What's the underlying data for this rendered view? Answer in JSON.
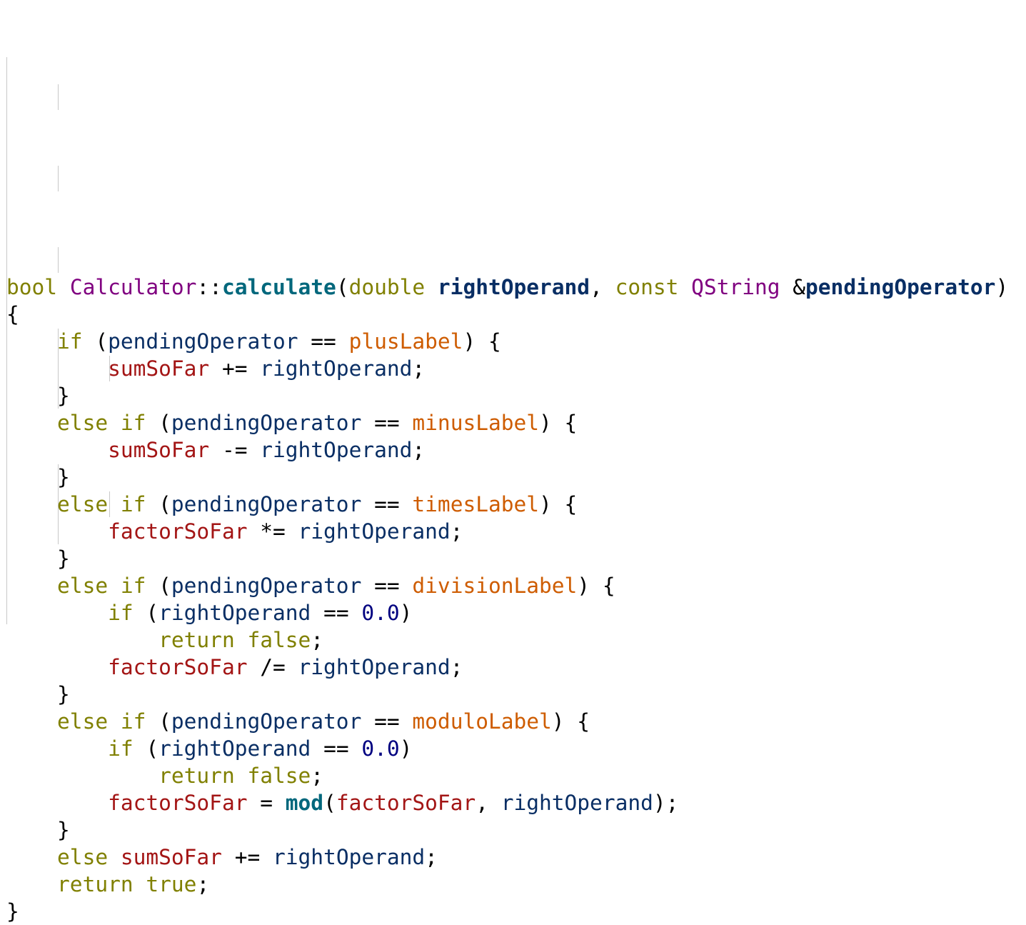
{
  "colors": {
    "background": "#ffffff",
    "indent_guide": "#c8c8c8",
    "k": "#808000",
    "t": "#800080",
    "f": "#00677c",
    "p": "#092e64",
    "m": "#a31515",
    "e": "#ce5c00",
    "n": "#000080",
    "o": "#000000",
    "d": "#000000",
    "bd": "#092e64"
  },
  "code": {
    "lines": [
      [
        [
          "k",
          "bool"
        ],
        [
          "d",
          " "
        ],
        [
          "t",
          "Calculator"
        ],
        [
          "d",
          "::"
        ],
        [
          "f",
          "calculate"
        ],
        [
          "d",
          "("
        ],
        [
          "k",
          "double"
        ],
        [
          "d",
          " "
        ],
        [
          "bd",
          "rightOperand"
        ],
        [
          "d",
          ", "
        ],
        [
          "k",
          "const"
        ],
        [
          "d",
          " "
        ],
        [
          "t",
          "QString"
        ],
        [
          "d",
          " &"
        ],
        [
          "bd",
          "pendingOperator"
        ],
        [
          "d",
          ")"
        ]
      ],
      [
        [
          "d",
          "{"
        ]
      ],
      [
        [
          "d",
          "    "
        ],
        [
          "k",
          "if"
        ],
        [
          "d",
          " ("
        ],
        [
          "p",
          "pendingOperator"
        ],
        [
          "d",
          " "
        ],
        [
          "o",
          "=="
        ],
        [
          "d",
          " "
        ],
        [
          "e",
          "plusLabel"
        ],
        [
          "d",
          ") {"
        ]
      ],
      [
        [
          "d",
          "        "
        ],
        [
          "m",
          "sumSoFar"
        ],
        [
          "d",
          " "
        ],
        [
          "o",
          "+="
        ],
        [
          "d",
          " "
        ],
        [
          "p",
          "rightOperand"
        ],
        [
          "d",
          ";"
        ]
      ],
      [
        [
          "d",
          "    }"
        ]
      ],
      [
        [
          "d",
          "    "
        ],
        [
          "k",
          "else"
        ],
        [
          "d",
          " "
        ],
        [
          "k",
          "if"
        ],
        [
          "d",
          " ("
        ],
        [
          "p",
          "pendingOperator"
        ],
        [
          "d",
          " "
        ],
        [
          "o",
          "=="
        ],
        [
          "d",
          " "
        ],
        [
          "e",
          "minusLabel"
        ],
        [
          "d",
          ") {"
        ]
      ],
      [
        [
          "d",
          "        "
        ],
        [
          "m",
          "sumSoFar"
        ],
        [
          "d",
          " "
        ],
        [
          "o",
          "-="
        ],
        [
          "d",
          " "
        ],
        [
          "p",
          "rightOperand"
        ],
        [
          "d",
          ";"
        ]
      ],
      [
        [
          "d",
          "    }"
        ]
      ],
      [
        [
          "d",
          "    "
        ],
        [
          "k",
          "else"
        ],
        [
          "d",
          " "
        ],
        [
          "k",
          "if"
        ],
        [
          "d",
          " ("
        ],
        [
          "p",
          "pendingOperator"
        ],
        [
          "d",
          " "
        ],
        [
          "o",
          "=="
        ],
        [
          "d",
          " "
        ],
        [
          "e",
          "timesLabel"
        ],
        [
          "d",
          ") {"
        ]
      ],
      [
        [
          "d",
          "        "
        ],
        [
          "m",
          "factorSoFar"
        ],
        [
          "d",
          " "
        ],
        [
          "o",
          "*="
        ],
        [
          "d",
          " "
        ],
        [
          "p",
          "rightOperand"
        ],
        [
          "d",
          ";"
        ]
      ],
      [
        [
          "d",
          "    }"
        ]
      ],
      [
        [
          "d",
          "    "
        ],
        [
          "k",
          "else"
        ],
        [
          "d",
          " "
        ],
        [
          "k",
          "if"
        ],
        [
          "d",
          " ("
        ],
        [
          "p",
          "pendingOperator"
        ],
        [
          "d",
          " "
        ],
        [
          "o",
          "=="
        ],
        [
          "d",
          " "
        ],
        [
          "e",
          "divisionLabel"
        ],
        [
          "d",
          ") {"
        ]
      ],
      [
        [
          "d",
          "        "
        ],
        [
          "k",
          "if"
        ],
        [
          "d",
          " ("
        ],
        [
          "p",
          "rightOperand"
        ],
        [
          "d",
          " "
        ],
        [
          "o",
          "=="
        ],
        [
          "d",
          " "
        ],
        [
          "n",
          "0.0"
        ],
        [
          "d",
          ")"
        ]
      ],
      [
        [
          "d",
          "            "
        ],
        [
          "k",
          "return"
        ],
        [
          "d",
          " "
        ],
        [
          "k",
          "false"
        ],
        [
          "d",
          ";"
        ]
      ],
      [
        [
          "d",
          "        "
        ],
        [
          "m",
          "factorSoFar"
        ],
        [
          "d",
          " "
        ],
        [
          "o",
          "/="
        ],
        [
          "d",
          " "
        ],
        [
          "p",
          "rightOperand"
        ],
        [
          "d",
          ";"
        ]
      ],
      [
        [
          "d",
          "    }"
        ]
      ],
      [
        [
          "d",
          "    "
        ],
        [
          "k",
          "else"
        ],
        [
          "d",
          " "
        ],
        [
          "k",
          "if"
        ],
        [
          "d",
          " ("
        ],
        [
          "p",
          "pendingOperator"
        ],
        [
          "d",
          " "
        ],
        [
          "o",
          "=="
        ],
        [
          "d",
          " "
        ],
        [
          "e",
          "moduloLabel"
        ],
        [
          "d",
          ") {"
        ]
      ],
      [
        [
          "d",
          "        "
        ],
        [
          "k",
          "if"
        ],
        [
          "d",
          " ("
        ],
        [
          "p",
          "rightOperand"
        ],
        [
          "d",
          " "
        ],
        [
          "o",
          "=="
        ],
        [
          "d",
          " "
        ],
        [
          "n",
          "0.0"
        ],
        [
          "d",
          ")"
        ]
      ],
      [
        [
          "d",
          "            "
        ],
        [
          "k",
          "return"
        ],
        [
          "d",
          " "
        ],
        [
          "k",
          "false"
        ],
        [
          "d",
          ";"
        ]
      ],
      [
        [
          "d",
          "        "
        ],
        [
          "m",
          "factorSoFar"
        ],
        [
          "d",
          " "
        ],
        [
          "o",
          "="
        ],
        [
          "d",
          " "
        ],
        [
          "f",
          "mod"
        ],
        [
          "d",
          "("
        ],
        [
          "m",
          "factorSoFar"
        ],
        [
          "d",
          ", "
        ],
        [
          "p",
          "rightOperand"
        ],
        [
          "d",
          ");"
        ]
      ],
      [
        [
          "d",
          "    }"
        ]
      ],
      [
        [
          "d",
          "    "
        ],
        [
          "k",
          "else"
        ],
        [
          "d",
          " "
        ],
        [
          "m",
          "sumSoFar"
        ],
        [
          "d",
          " "
        ],
        [
          "o",
          "+="
        ],
        [
          "d",
          " "
        ],
        [
          "p",
          "rightOperand"
        ],
        [
          "d",
          ";"
        ]
      ],
      [
        [
          "d",
          "    "
        ],
        [
          "k",
          "return"
        ],
        [
          "d",
          " "
        ],
        [
          "k",
          "true"
        ],
        [
          "d",
          ";"
        ]
      ],
      [
        [
          "d",
          "}"
        ]
      ]
    ]
  }
}
